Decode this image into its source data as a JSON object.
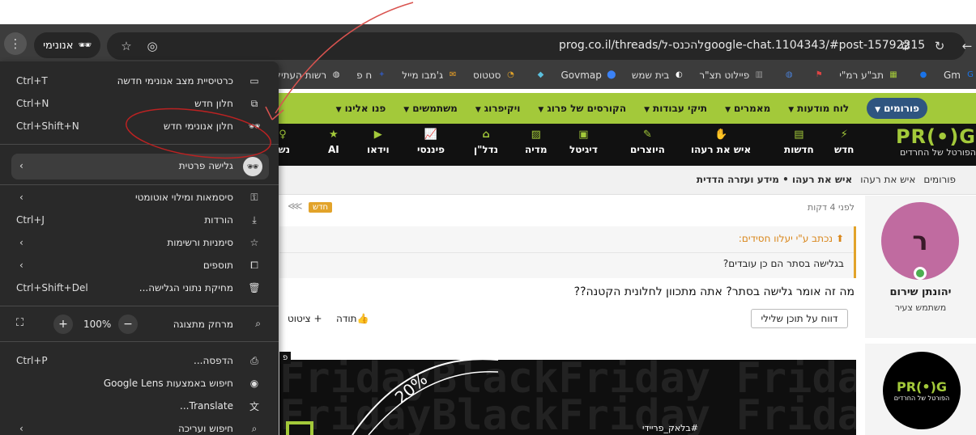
{
  "browser": {
    "url": "prog.co.il/threads/להכנס-לgoogle-chat.1104343/#post-15792215",
    "incognito_label": "אנונימי"
  },
  "bookmarks": [
    {
      "label": "Gm",
      "icon": "gmail-icon",
      "color": "#1a73e8"
    },
    {
      "label": "",
      "icon": "circle-icon",
      "color": "#1a73e8"
    },
    {
      "label": "תב\"ע רמ\"י",
      "icon": "map-icon",
      "color": "#a3c93a"
    },
    {
      "label": "",
      "icon": "flag-icon",
      "color": "#d44"
    },
    {
      "label": "",
      "icon": "globe-icon",
      "color": "#4a7fd4"
    },
    {
      "label": "פיילוט תצ\"ר",
      "icon": "building-icon",
      "color": "#999"
    },
    {
      "label": "בית שמש",
      "icon": "logo-icon",
      "color": "#fff"
    },
    {
      "label": "Govmap",
      "icon": "pin-icon",
      "color": "#3b82f6"
    },
    {
      "label": "",
      "icon": "pin2-icon",
      "color": "#5bc0de"
    },
    {
      "label": "סטטוס",
      "icon": "status-icon",
      "color": "#e2a32a"
    },
    {
      "label": "ג'מבו מייל",
      "icon": "mail-icon",
      "color": "#f5a623"
    },
    {
      "label": "ח פ",
      "icon": "gov-icon",
      "color": "#3355aa"
    },
    {
      "label": "רשות העתיקות",
      "icon": "globe-icon",
      "color": "#ddd"
    }
  ],
  "greennav": {
    "items": [
      "פורומים",
      "לוח מודעות",
      "מאמרים",
      "תיקי עבודות",
      "הקורסים של פרוג",
      "ויקיפרוג",
      "משתמשים",
      "פנו אלינו"
    ]
  },
  "blacknav": {
    "logo": "PR(•)G",
    "logo_sub": "הפורטל של החרדים",
    "items": [
      "חדש",
      "חדשות",
      "איש את רעהו",
      "היוצרים",
      "דיגיטל",
      "מדיה",
      "נדל\"ן",
      "פיננסי",
      "וידאו",
      "AI",
      "נשי"
    ]
  },
  "breadcrumb": [
    "פורומים",
    "איש את רעהו",
    "איש את רעהו • מידע ועזרה הדדית"
  ],
  "post": {
    "author_initial": "ר",
    "author_name": "יהונתן שירום",
    "author_role": "משתמש צעיר",
    "time": "לפני 4 דקות",
    "badge": "חדש",
    "quote_by": "נכתב ע\"י יעלוו חסידים:",
    "quote_text": "בגלישה בסתר הם כן עובדים?",
    "body": "מה זה אומר גלישה בסתר? אתה מתכוון לחלונית הקטנה??",
    "report": "דווח על תוכן שלילי",
    "thanks": "תודה",
    "quote_btn": "ציטוט"
  },
  "post2": {
    "logo": "PR(•)G",
    "logo_sub": "הפורטל של החרדים",
    "banner_bg": "FridayBlackFriday",
    "banner_percent": "20%",
    "banner_hashtag": "#בלאק_פריידי",
    "banner_tag": "פ"
  },
  "menu": {
    "new_incognito_tab": {
      "label": "כרטיסיית מצב אנונימי חדשה",
      "shortcut": "Ctrl+T"
    },
    "new_window": {
      "label": "חלון חדש",
      "shortcut": "Ctrl+N"
    },
    "new_incognito_window": {
      "label": "חלון אנונימי חדש",
      "shortcut": "Ctrl+Shift+N"
    },
    "private_browsing": {
      "label": "גלישה פרטית"
    },
    "passwords": {
      "label": "סיסמאות ומילוי אוטומטי"
    },
    "downloads": {
      "label": "הורדות",
      "shortcut": "Ctrl+J"
    },
    "bookmarks": {
      "label": "סימניות ורשימות"
    },
    "extensions": {
      "label": "תוספים"
    },
    "clear_data": {
      "label": "מחיקת נתוני הגלישה...",
      "shortcut": "Ctrl+Shift+Del"
    },
    "zoom": {
      "label": "מרחק מתצוגה",
      "value": "100%"
    },
    "print": {
      "label": "הדפסה...",
      "shortcut": "Ctrl+P"
    },
    "lens": {
      "label": "חיפוש באמצעות Google Lens"
    },
    "translate": {
      "label": "Translate..."
    },
    "find_edit": {
      "label": "חיפוש ועריכה"
    }
  }
}
